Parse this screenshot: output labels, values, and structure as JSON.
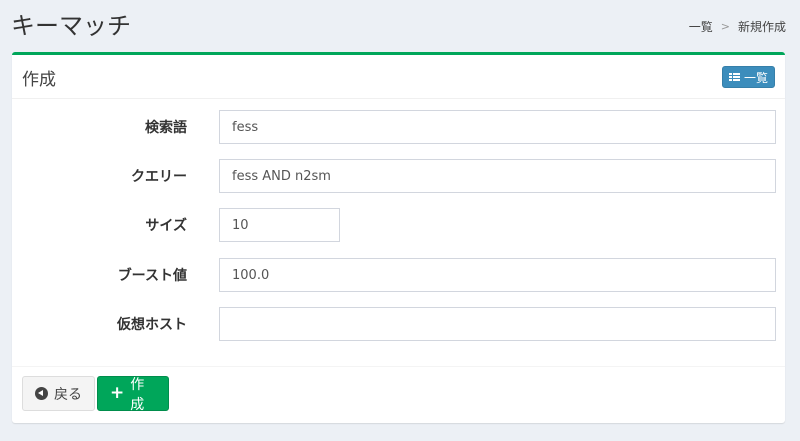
{
  "header": {
    "title": "キーマッチ",
    "breadcrumb": {
      "link": "一覧",
      "separator": ">",
      "current": "新規作成"
    }
  },
  "card": {
    "title": "作成",
    "list_button_label": "一覧",
    "accent_color": "#00a65a"
  },
  "form": {
    "fields": [
      {
        "label": "検索語",
        "value": "fess"
      },
      {
        "label": "クエリー",
        "value": "fess AND n2sm"
      },
      {
        "label": "サイズ",
        "value": "10"
      },
      {
        "label": "ブースト値",
        "value": "100.0"
      },
      {
        "label": "仮想ホスト",
        "value": ""
      }
    ]
  },
  "footer": {
    "back_label": "戻る",
    "create_label": "作成"
  },
  "icons": {
    "list": "list-icon",
    "back": "circle-arrow-left-icon",
    "create": "plus-icon"
  }
}
